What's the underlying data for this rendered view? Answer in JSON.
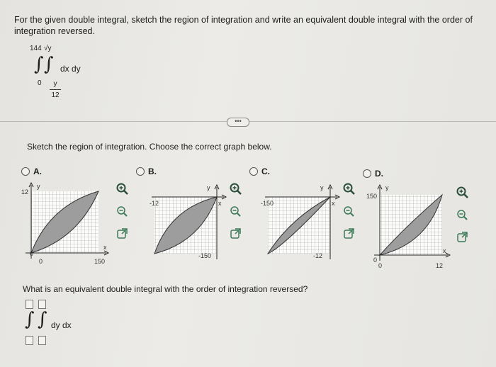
{
  "question": {
    "prompt": "For the given double integral, sketch the region of integration and write an equivalent double integral with the order of integration reversed.",
    "sketch_prompt": "Sketch the region of integration. Choose the correct graph below.",
    "reverse_prompt": "What is an equivalent double integral with the order of integration reversed?"
  },
  "given_integral": {
    "sign": "∫",
    "outer_upper": "144",
    "inner_upper": "√y",
    "outer_lower": "0",
    "inner_lower_num": "y",
    "inner_lower_den": "12",
    "integrand": "dx dy"
  },
  "answer_integral": {
    "sign": "∫",
    "integrand": "dy dx"
  },
  "ui": {
    "more": "•••"
  },
  "options": [
    {
      "label": "A.",
      "y_label": "y",
      "x_label": "x",
      "y_tick": "12",
      "x_tick": "150",
      "zero": "0"
    },
    {
      "label": "B.",
      "y_label": "y",
      "x_label": "x",
      "x_tick": "-12",
      "y_tick": "-150"
    },
    {
      "label": "C.",
      "y_label": "y",
      "x_label": "x",
      "x_tick": "-150",
      "y_tick": "-12"
    },
    {
      "label": "D.",
      "y_label": "y",
      "x_label": "x",
      "y_tick": "150",
      "x_tick": "12",
      "zero": "0"
    }
  ],
  "icons": [
    "zoom-in-icon",
    "zoom-out-icon",
    "open-new-window-icon"
  ],
  "colors": {
    "icon_green": "#2b4e3a",
    "shaded_region": "#9d9d9d"
  }
}
